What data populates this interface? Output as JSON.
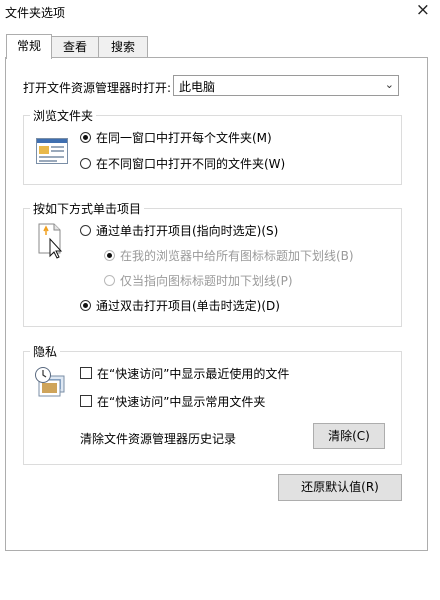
{
  "window": {
    "title": "文件夹选项",
    "close_glyph": "×"
  },
  "tabs": [
    {
      "label": "常规",
      "active": true
    },
    {
      "label": "查看",
      "active": false
    },
    {
      "label": "搜索",
      "active": false
    }
  ],
  "open_with": {
    "label": "打开文件资源管理器时打开:",
    "value": "此电脑"
  },
  "browse": {
    "title": "浏览文件夹",
    "icon": "folder-window-icon",
    "options": [
      {
        "label": "在同一窗口中打开每个文件夹(M)",
        "checked": true
      },
      {
        "label": "在不同窗口中打开不同的文件夹(W)",
        "checked": false
      }
    ]
  },
  "click": {
    "title": "按如下方式单击项目",
    "icon": "pointer-document-icon",
    "single": {
      "label": "通过单击打开项目(指向时选定)(S)",
      "checked": false
    },
    "sub1": {
      "label": "在我的浏览器中给所有图标标题加下划线(B)",
      "checked": true,
      "disabled": true
    },
    "sub2": {
      "label": "仅当指向图标标题时加下划线(P)",
      "checked": false,
      "disabled": true
    },
    "double": {
      "label": "通过双击打开项目(单击时选定)(D)",
      "checked": true
    }
  },
  "privacy": {
    "title": "隐私",
    "icon": "privacy-icon",
    "recent": {
      "label": "在“快速访问”中显示最近使用的文件",
      "checked": false
    },
    "frequent": {
      "label": "在“快速访问”中显示常用文件夹",
      "checked": false
    },
    "clear_label": "清除文件资源管理器历史记录",
    "clear_button": "清除(C)"
  },
  "restore_button": "还原默认值(R)"
}
